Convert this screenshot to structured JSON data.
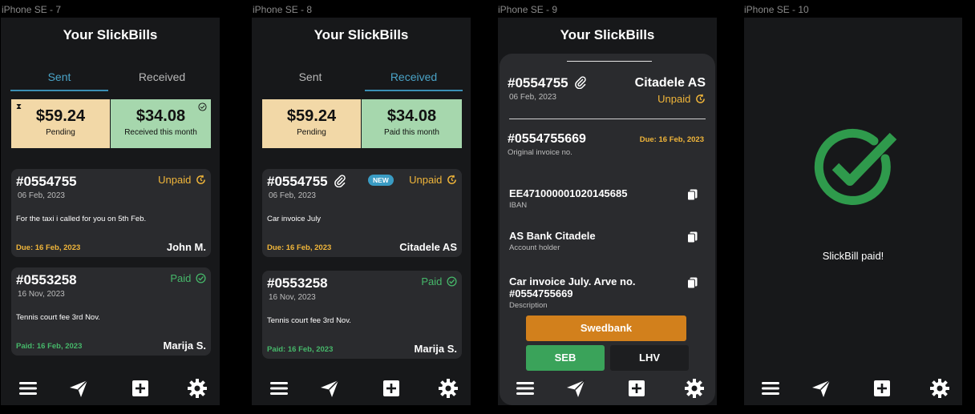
{
  "frames": {
    "f1": "iPhone SE - 7",
    "f2": "iPhone SE - 8",
    "f3": "iPhone SE - 9",
    "f4": "iPhone SE - 10"
  },
  "app_title": "Your SlickBills",
  "screen1": {
    "tabs": {
      "sent": "Sent",
      "received": "Received"
    },
    "summary": {
      "pending_amount": "$59.24",
      "pending_label": "Pending",
      "second_amount": "$34.08",
      "second_label": "Received this month"
    },
    "bills": [
      {
        "number": "#0554755",
        "date": "06 Feb, 2023",
        "status": "Unpaid",
        "description": "For the taxi i called for you on 5th Feb.",
        "due": "Due: 16 Feb, 2023",
        "person": "John M."
      },
      {
        "number": "#0553258",
        "date": "16 Nov, 2023",
        "status": "Paid",
        "description": "Tennis court fee 3rd Nov.",
        "due": "Paid: 16 Feb, 2023",
        "person": "Marija S."
      }
    ]
  },
  "screen2": {
    "tabs": {
      "sent": "Sent",
      "received": "Received"
    },
    "summary": {
      "pending_amount": "$59.24",
      "pending_label": "Pending",
      "second_amount": "$34.08",
      "second_label": "Paid this month"
    },
    "new_badge": "NEW",
    "bills": [
      {
        "number": "#0554755",
        "date": "06 Feb, 2023",
        "status": "Unpaid",
        "description": "Car invoice July",
        "due": "Due: 16 Feb, 2023",
        "person": "Citadele AS"
      },
      {
        "number": "#0553258",
        "date": "16 Nov, 2023",
        "status": "Paid",
        "description": "Tennis court fee 3rd Nov.",
        "due": "Paid: 16 Feb, 2023",
        "person": "Marija S."
      }
    ]
  },
  "screen3": {
    "bill_number": "#0554755",
    "bill_date": "06 Feb, 2023",
    "issuer": "Citadele AS",
    "status": "Unpaid",
    "invoice_number": "#0554755669",
    "invoice_label": "Original invoice no.",
    "due": "Due: 16 Feb, 2023",
    "iban": "EE471000001020145685",
    "iban_label": "IBAN",
    "holder": "AS Bank Citadele",
    "holder_label": "Account holder",
    "description_line1": "Car invoice July. Arve no.",
    "description_line2": "#0554755669",
    "description_label": "Description",
    "banks": {
      "swedbank": "Swedbank",
      "seb": "SEB",
      "lhv": "LHV"
    }
  },
  "screen4": {
    "message": "SlickBill paid!"
  },
  "colors": {
    "background": "#17181a",
    "card": "#2a2b2e",
    "accent_blue": "#3a8fb5",
    "unpaid": "#f1b63a",
    "paid": "#46b86a",
    "pending_card": "#f2d8a7",
    "received_card": "#a6d7ad",
    "swedbank": "#d2801c",
    "seb": "#3aa35a",
    "lhv": "#303134"
  },
  "nav_icons": [
    "menu-icon",
    "send-icon",
    "add-icon",
    "settings-icon"
  ]
}
